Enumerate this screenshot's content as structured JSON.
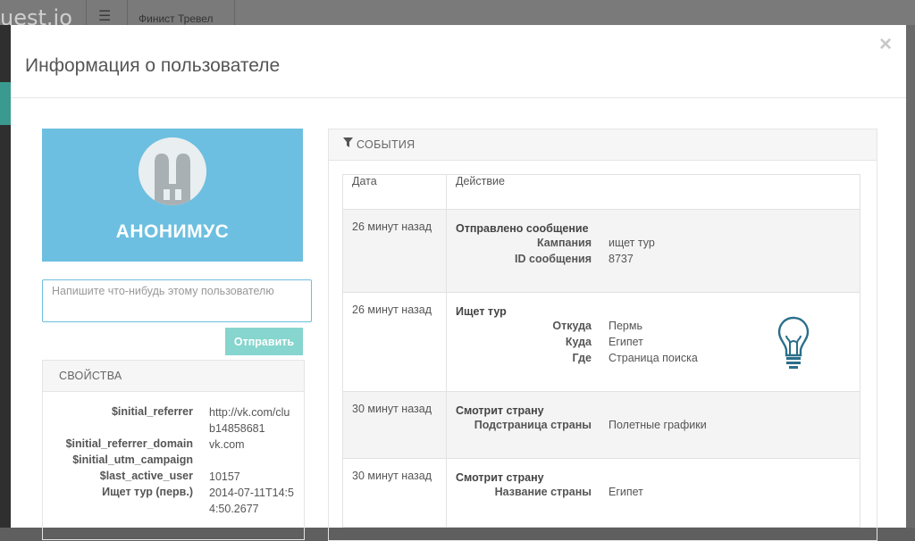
{
  "background": {
    "logo_text": "uest.io",
    "menu_icon": "hamburger-icon",
    "project_name": "Финист Тревел"
  },
  "modal": {
    "title": "Информация о пользователе",
    "close_icon": "×"
  },
  "profile": {
    "name": "АНОНИМУС",
    "avatar_icon": "bunny-avatar-icon",
    "card_color": "#6cbfe0"
  },
  "message": {
    "placeholder": "Напишите что-нибудь этому пользователю",
    "send_label": "Отправить"
  },
  "properties": {
    "title": "СВОЙСТВА",
    "items": [
      {
        "key": "$initial_referrer",
        "value": "http://vk.com/club14858681"
      },
      {
        "key": "$initial_referrer_domain",
        "value": "vk.com"
      },
      {
        "key": "$initial_utm_campaign",
        "value": ""
      },
      {
        "key": "$last_active_user",
        "value": "10157"
      },
      {
        "key": "Ищет тур (перв.)",
        "value": "2014-07-11T14:54:50.2677"
      }
    ]
  },
  "events": {
    "title": "СОБЫТИЯ",
    "filter_icon": "filter-icon",
    "columns": [
      "Дата",
      "Действие"
    ],
    "rows": [
      {
        "date": "26 минут назад",
        "title": "Отправлено сообщение",
        "props": [
          {
            "key": "Кампания",
            "value": "ищет тур"
          },
          {
            "key": "ID сообщения",
            "value": "8737"
          }
        ]
      },
      {
        "date": "26 минут назад",
        "title": "Ищет тур",
        "icon": "lightbulb-icon",
        "props": [
          {
            "key": "Откуда",
            "value": "Пермь"
          },
          {
            "key": "Куда",
            "value": "Египет"
          },
          {
            "key": "Где",
            "value": "Страница поиска"
          }
        ]
      },
      {
        "date": "30 минут назад",
        "title": "Смотрит страну",
        "props": [
          {
            "key": "Подстраница страны",
            "value": "Полетные графики"
          }
        ]
      },
      {
        "date": "30 минут назад",
        "title": "Смотрит страну",
        "props": [
          {
            "key": "Название страны",
            "value": "Египет"
          }
        ]
      }
    ]
  }
}
